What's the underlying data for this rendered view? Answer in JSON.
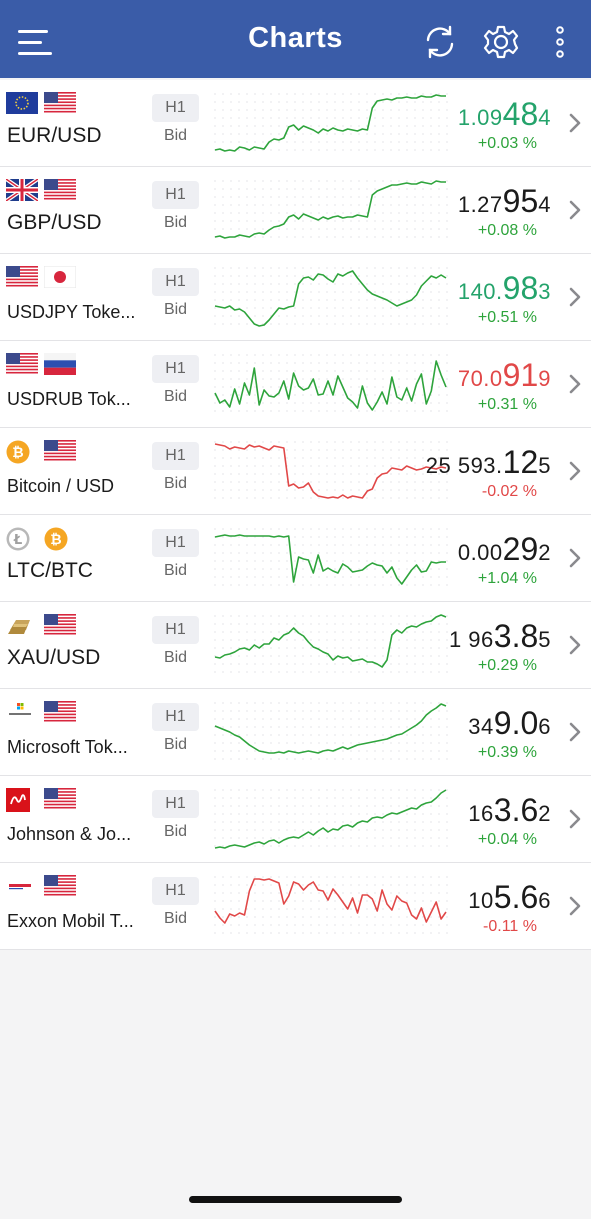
{
  "header": {
    "title": "Charts"
  },
  "icons": {
    "menu": "menu-icon",
    "refresh": "refresh-icon",
    "settings": "gear-icon",
    "more": "more-vertical-icon",
    "chevron": "chevron-right-icon"
  },
  "colors": {
    "header": "#3a5ca8",
    "up": "#2ea43c",
    "down": "#e14848",
    "neutral": "#1b1b1b"
  },
  "rows": [
    {
      "name": "EUR/USD",
      "flags": [
        "eu-flag-icon",
        "us-flag-icon"
      ],
      "timeframe": "H1",
      "price_type": "Bid",
      "price_pre": "1.09",
      "price_big": "48",
      "price_post": "4",
      "price_color": "up",
      "change": "+0.03 %",
      "change_dir": "up",
      "spark": [
        58,
        57,
        59,
        58,
        59,
        55,
        56,
        58,
        55,
        56,
        57,
        50,
        47,
        48,
        46,
        35,
        33,
        38,
        34,
        36,
        38,
        41,
        37,
        39,
        36,
        38,
        39,
        37,
        38,
        39,
        37,
        38,
        16,
        9,
        8,
        7,
        8,
        6,
        6,
        5,
        6,
        6,
        4,
        5,
        5,
        3,
        4,
        4
      ],
      "spark_color": "up"
    },
    {
      "name": "GBP/USD",
      "flags": [
        "gb-flag-icon",
        "us-flag-icon"
      ],
      "timeframe": "H1",
      "price_type": "Bid",
      "price_pre": "1.27",
      "price_big": "95",
      "price_post": "4",
      "price_color": "neutral",
      "change": "+0.08 %",
      "change_dir": "up",
      "spark": [
        58,
        57,
        59,
        58,
        58,
        56,
        57,
        58,
        55,
        54,
        55,
        51,
        48,
        47,
        45,
        38,
        36,
        40,
        35,
        37,
        39,
        41,
        38,
        40,
        38,
        37,
        39,
        38,
        38,
        36,
        37,
        38,
        16,
        12,
        10,
        8,
        6,
        6,
        5,
        4,
        5,
        5,
        3,
        4,
        5,
        2,
        3,
        3
      ],
      "spark_color": "up"
    },
    {
      "name": "USDJPY Toke...",
      "flags": [
        "us-flag-icon",
        "jp-flag-icon"
      ],
      "timeframe": "H1",
      "price_type": "Bid",
      "price_pre": "140.",
      "price_big": "98",
      "price_post": "3",
      "price_color": "up",
      "change": "+0.51 %",
      "change_dir": "up",
      "spark": [
        40,
        41,
        42,
        40,
        44,
        43,
        46,
        52,
        58,
        60,
        59,
        54,
        48,
        42,
        43,
        41,
        40,
        18,
        12,
        11,
        14,
        8,
        9,
        13,
        16,
        8,
        10,
        7,
        5,
        12,
        18,
        24,
        28,
        30,
        32,
        34,
        37,
        40,
        38,
        36,
        34,
        29,
        20,
        15,
        10,
        12,
        9,
        12
      ],
      "spark_color": "up"
    },
    {
      "name": "USDRUB Tok...",
      "flags": [
        "us-flag-icon",
        "ru-flag-icon"
      ],
      "timeframe": "H1",
      "price_type": "Bid",
      "price_pre": "70.0",
      "price_big": "91",
      "price_post": "9",
      "price_color": "down",
      "change": "+0.31 %",
      "change_dir": "up",
      "spark": [
        40,
        50,
        47,
        54,
        36,
        51,
        30,
        42,
        15,
        52,
        37,
        43,
        44,
        40,
        28,
        46,
        20,
        33,
        37,
        35,
        26,
        42,
        41,
        28,
        42,
        23,
        34,
        45,
        49,
        55,
        33,
        50,
        57,
        49,
        39,
        51,
        24,
        44,
        47,
        35,
        48,
        31,
        21,
        51,
        38,
        8,
        22,
        34
      ],
      "spark_color": "up"
    },
    {
      "name": "Bitcoin / USD",
      "flags": [
        "btc-coin-icon",
        "us-flag-icon"
      ],
      "timeframe": "H1",
      "price_type": "Bid",
      "price_pre": "25 593.",
      "price_big": "12",
      "price_post": "5",
      "price_color": "neutral",
      "change": "-0.02 %",
      "change_dir": "down",
      "spark": [
        4,
        5,
        6,
        9,
        7,
        8,
        9,
        5,
        7,
        6,
        8,
        10,
        6,
        7,
        8,
        46,
        44,
        48,
        47,
        43,
        52,
        56,
        57,
        58,
        57,
        58,
        55,
        58,
        56,
        57,
        58,
        51,
        49,
        38,
        34,
        33,
        28,
        29,
        30,
        26,
        28,
        30,
        29,
        27,
        28,
        29,
        27,
        28
      ],
      "spark_color": "down"
    },
    {
      "name": "LTC/BTC",
      "flags": [
        "ltc-coin-icon",
        "btc-coin-icon"
      ],
      "timeframe": "H1",
      "price_type": "Bid",
      "price_pre": "0.00",
      "price_big": "29",
      "price_post": "2",
      "price_color": "neutral",
      "change": "+1.04 %",
      "change_dir": "up",
      "spark": [
        10,
        9,
        8,
        9,
        9,
        8,
        9,
        9,
        9,
        9,
        9,
        9,
        10,
        9,
        10,
        9,
        55,
        30,
        32,
        33,
        46,
        28,
        44,
        41,
        44,
        46,
        37,
        40,
        45,
        44,
        43,
        39,
        36,
        38,
        39,
        46,
        40,
        51,
        57,
        50,
        43,
        38,
        45,
        44,
        35,
        36,
        35,
        35
      ],
      "spark_color": "up"
    },
    {
      "name": "XAU/USD",
      "flags": [
        "gold-bar-icon",
        "us-flag-icon"
      ],
      "timeframe": "H1",
      "price_type": "Bid",
      "price_pre": "1 96",
      "price_big": "3.8",
      "price_post": "5",
      "price_color": "neutral",
      "change": "+0.29 %",
      "change_dir": "up",
      "spark": [
        43,
        44,
        41,
        40,
        38,
        35,
        34,
        36,
        31,
        34,
        30,
        30,
        24,
        26,
        21,
        19,
        14,
        19,
        22,
        28,
        33,
        35,
        38,
        40,
        46,
        42,
        44,
        43,
        47,
        46,
        45,
        48,
        48,
        50,
        53,
        46,
        21,
        16,
        19,
        14,
        12,
        13,
        10,
        8,
        7,
        3,
        1,
        3
      ],
      "spark_color": "up"
    },
    {
      "name": "Microsoft Tok...",
      "flags": [
        "microsoft-logo-icon",
        "us-flag-icon"
      ],
      "timeframe": "H1",
      "price_type": "Bid",
      "price_pre": "34",
      "price_big": "9.0",
      "price_post": "6",
      "price_color": "neutral",
      "change": "+0.39 %",
      "change_dir": "up",
      "spark": [
        25,
        27,
        29,
        31,
        34,
        36,
        40,
        44,
        47,
        50,
        51,
        52,
        52,
        51,
        52,
        50,
        51,
        52,
        51,
        50,
        51,
        52,
        50,
        49,
        50,
        48,
        46,
        48,
        46,
        44,
        43,
        42,
        41,
        40,
        39,
        38,
        36,
        34,
        33,
        30,
        27,
        24,
        20,
        14,
        10,
        7,
        3,
        5
      ],
      "spark_color": "up"
    },
    {
      "name": "Johnson & Jo...",
      "flags": [
        "jnj-logo-icon",
        "us-flag-icon"
      ],
      "timeframe": "H1",
      "price_type": "Bid",
      "price_pre": "16",
      "price_big": "3.6",
      "price_post": "2",
      "price_color": "neutral",
      "change": "+0.04 %",
      "change_dir": "up",
      "spark": [
        60,
        59,
        60,
        58,
        57,
        58,
        59,
        57,
        55,
        54,
        56,
        53,
        52,
        55,
        52,
        50,
        49,
        50,
        47,
        44,
        47,
        43,
        40,
        44,
        41,
        42,
        38,
        37,
        39,
        35,
        33,
        34,
        30,
        29,
        30,
        27,
        25,
        26,
        24,
        22,
        20,
        21,
        17,
        15,
        14,
        10,
        5,
        2
      ],
      "spark_color": "up"
    },
    {
      "name": "Exxon Mobil T...",
      "flags": [
        "exxon-logo-icon",
        "us-flag-icon"
      ],
      "timeframe": "H1",
      "price_type": "Bid",
      "price_pre": "10",
      "price_big": "5.6",
      "price_post": "6",
      "price_color": "neutral",
      "change": "-0.11 %",
      "change_dir": "down",
      "spark": [
        36,
        43,
        48,
        39,
        41,
        38,
        40,
        16,
        4,
        4,
        5,
        4,
        6,
        8,
        29,
        21,
        7,
        9,
        15,
        10,
        7,
        15,
        16,
        25,
        14,
        20,
        27,
        34,
        23,
        38,
        20,
        20,
        24,
        36,
        15,
        29,
        35,
        21,
        26,
        28,
        40,
        44,
        33,
        47,
        37,
        27,
        44,
        37
      ],
      "spark_color": "down"
    }
  ]
}
